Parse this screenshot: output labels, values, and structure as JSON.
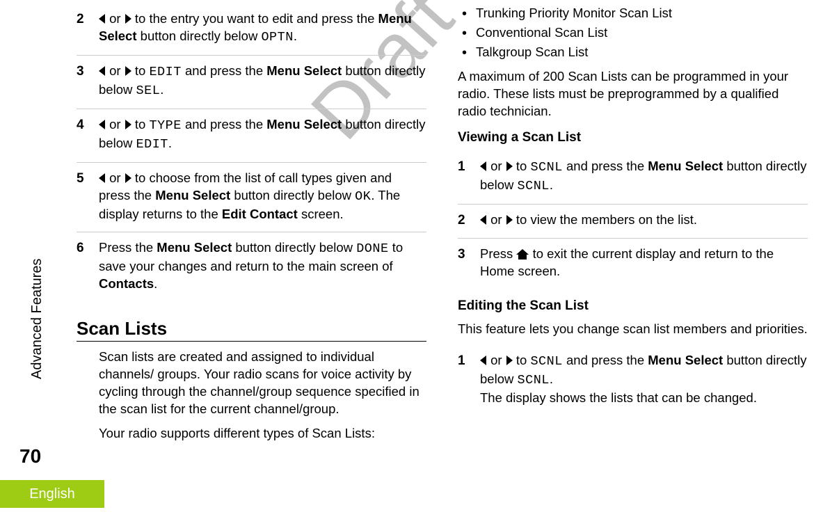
{
  "side": {
    "chapter_label": "Advanced Features",
    "page_number": "70",
    "language": "English"
  },
  "watermark": "Draft",
  "left_col": {
    "steps": [
      {
        "num": "2",
        "pre": "",
        "mid": " or ",
        "post1": " to the entry you want to edit and press the ",
        "b1": "Menu Select",
        "post2": " button directly below ",
        "code1": "OPTN",
        "tail": "."
      },
      {
        "num": "3",
        "pre": "",
        "mid": " or ",
        "post1": " to ",
        "code1": "EDIT",
        "post2": " and press the ",
        "b1": "Menu Select",
        "post3": " button directly below ",
        "code2": "SEL",
        "tail": "."
      },
      {
        "num": "4",
        "pre": "",
        "mid": " or ",
        "post1": " to ",
        "code1": "TYPE",
        "post2": " and press the ",
        "b1": "Menu Select",
        "post3": " button directly below ",
        "code2": "EDIT",
        "tail": "."
      },
      {
        "num": "5",
        "pre": "",
        "mid": " or ",
        "post1": " to choose from the list of call types given and press the ",
        "b1": "Menu Select",
        "post2": " button directly below ",
        "code1": "OK",
        "post3": ". The display returns to the ",
        "b2": "Edit Contact",
        "tail": " screen."
      },
      {
        "num": "6",
        "pre": "Press the ",
        "b1": "Menu Select",
        "post1": " button directly below ",
        "code1": "DONE",
        "post2": " to save your changes and return to the main screen of ",
        "b2": "Contacts",
        "tail": "."
      }
    ],
    "section_title": "Scan Lists",
    "para1": "Scan lists are created and assigned to individual channels/ groups. Your radio scans for voice activity by cycling through the channel/group sequence specified in the scan list for the current channel/group.",
    "para2": "Your radio supports different types of Scan Lists:"
  },
  "right_col": {
    "bullets": [
      "Trunking Priority Monitor Scan List",
      "Conventional Scan List",
      "Talkgroup Scan List"
    ],
    "para1": "A maximum of 200 Scan Lists can be programmed in your radio. These lists must be preprogrammed by a qualified radio technician.",
    "heading1": "Viewing a Scan List",
    "view_steps": [
      {
        "num": "1",
        "mid": " or ",
        "post1": " to ",
        "code1": "SCNL",
        "post2": " and press the ",
        "b1": "Menu Select",
        "post3": " button directly below ",
        "code2": "SCNL",
        "tail": "."
      },
      {
        "num": "2",
        "mid": " or ",
        "post1": " to view the members on the list.",
        "tail": ""
      },
      {
        "num": "3",
        "pre": "Press ",
        "post1": " to exit the current display and return to the Home screen.",
        "tail": ""
      }
    ],
    "heading2": "Editing the Scan List",
    "para2": "This feature lets you change scan list members and priorities.",
    "edit_steps": [
      {
        "num": "1",
        "mid": " or ",
        "post1": " to ",
        "code1": "SCNL",
        "post2": " and press the ",
        "b1": "Menu Select",
        "post3": " button directly below ",
        "code2": "SCNL",
        "tail1": ".",
        "line2": "The display shows the lists that can be changed."
      }
    ]
  }
}
